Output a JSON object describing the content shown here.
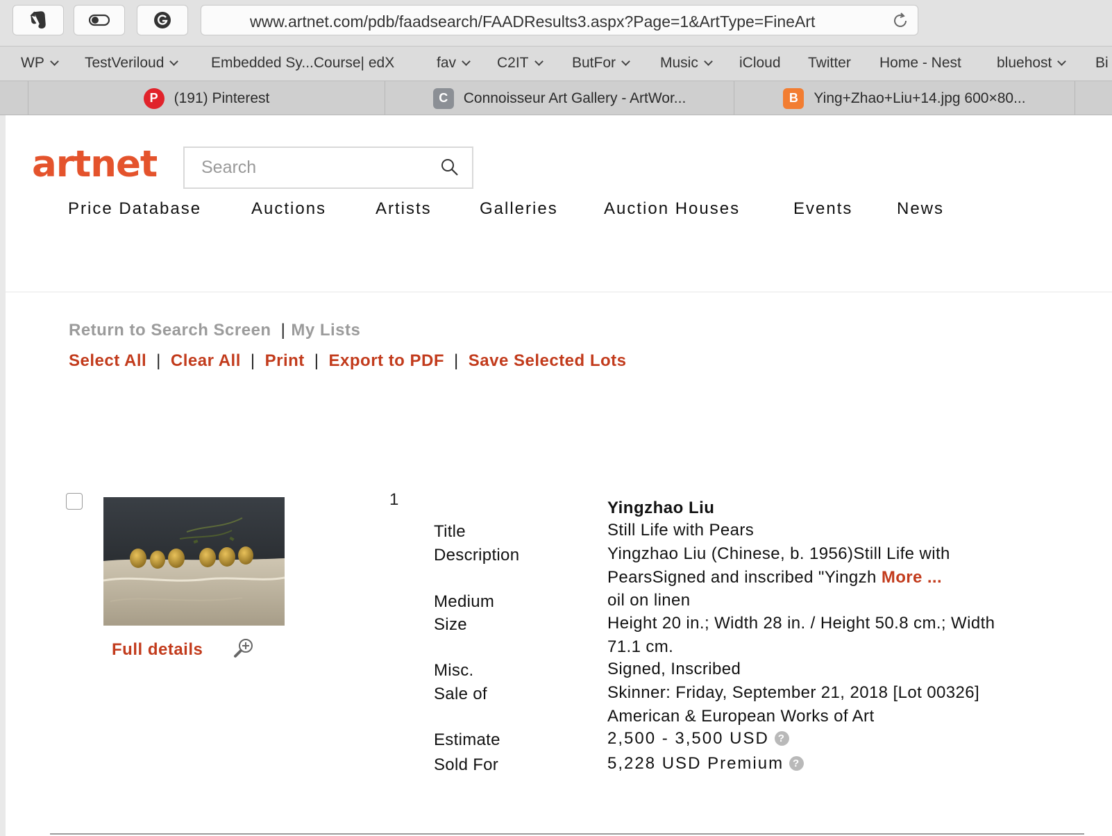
{
  "browser": {
    "url": "www.artnet.com/pdb/faadsearch/FAADResults3.aspx?Page=1&ArtType=FineArt",
    "bookmarks": [
      "WP",
      "TestVeriloud",
      "Embedded Sy...Course| edX",
      "fav",
      "C2IT",
      "ButFor",
      "Music",
      "iCloud",
      "Twitter",
      "Home - Nest",
      "bluehost",
      "Bi"
    ],
    "tabs": [
      {
        "label": "(191) Pinterest",
        "icon": "pinterest-icon",
        "color": "#e1232b"
      },
      {
        "label": "Connoisseur Art Gallery - ArtWor...",
        "icon": "c-letter-icon",
        "color": "#8b8f95"
      },
      {
        "label": "Ying+Zhao+Liu+14.jpg 600×80...",
        "icon": "blogger-icon",
        "color": "#f27d31"
      }
    ]
  },
  "site": {
    "logo": "artnet",
    "accent_color": "#e4532c",
    "link_color": "#c23b1c",
    "search_placeholder": "Search",
    "nav": [
      "Price Database",
      "Auctions",
      "Artists",
      "Galleries",
      "Auction Houses",
      "Events",
      "News"
    ]
  },
  "actions": {
    "return_label": "Return to Search Screen",
    "mylists_label": "My Lists",
    "select_all": "Select All",
    "clear_all": "Clear All",
    "print": "Print",
    "export_pdf": "Export to PDF",
    "save_lots": "Save Selected Lots"
  },
  "lot": {
    "number": "1",
    "full_details": "Full details",
    "artist": "Yingzhao Liu",
    "labels": {
      "title": "Title",
      "description": "Description",
      "medium": "Medium",
      "size": "Size",
      "misc": "Misc.",
      "sale": "Sale of",
      "estimate": "Estimate",
      "sold": "Sold For"
    },
    "title": "Still Life with Pears",
    "description_line1": "Yingzhao Liu (Chinese, b. 1956)Still Life with",
    "description_line2": "PearsSigned and inscribed \"Yingzh",
    "more": "More ...",
    "medium": "oil on linen",
    "size_line1": "Height 20 in.; Width 28 in. / Height 50.8 cm.; Width",
    "size_line2": "71.1 cm.",
    "misc": "Signed, Inscribed",
    "sale_line1": "Skinner: Friday, September 21, 2018 [Lot 00326]",
    "sale_line2": "American & European Works of Art",
    "estimate": "2,500 - 3,500 USD",
    "sold": "5,228 USD Premium"
  }
}
